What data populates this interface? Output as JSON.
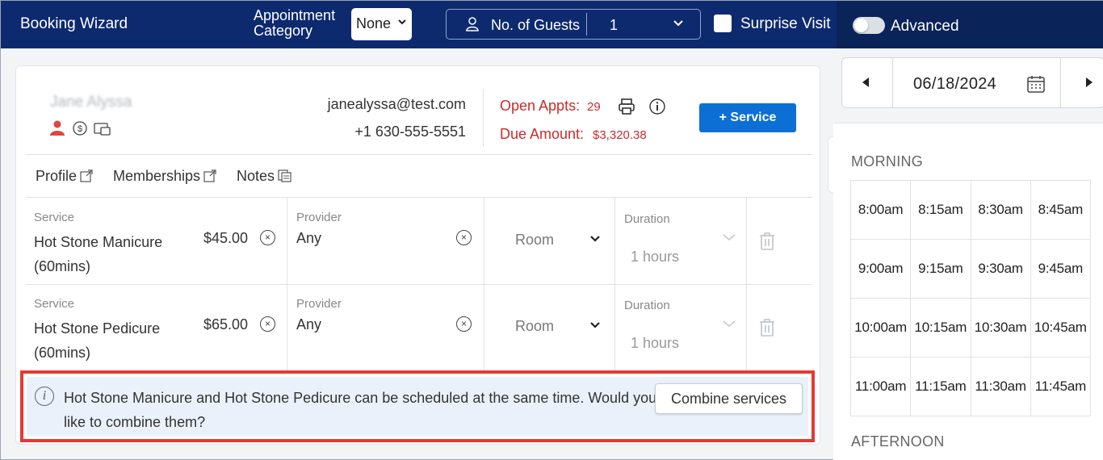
{
  "header": {
    "title": "Booking Wizard",
    "category_label": "Appointment Category",
    "category_value": "None",
    "guests_label": "No. of Guests",
    "guests_value": "1",
    "surprise_label": "Surprise Visit",
    "advanced_label": "Advanced"
  },
  "client": {
    "name": "Jane Alyssa",
    "email": "janealyssa@test.com",
    "phone": "+1 630-555-5551",
    "open_appts_label": "Open Appts:",
    "open_appts_value": "29",
    "due_label": "Due Amount:",
    "due_value": "$3,320.38",
    "service_button": "Service"
  },
  "tabs": [
    "Profile",
    "Memberships",
    "Notes"
  ],
  "labels": {
    "service": "Service",
    "provider": "Provider",
    "duration": "Duration"
  },
  "services": [
    {
      "name": "Hot Stone Manicure (60mins)",
      "price": "$45.00",
      "provider": "Any",
      "room": "Room",
      "duration": "1 hours"
    },
    {
      "name": "Hot Stone Pedicure (60mins)",
      "price": "$65.00",
      "provider": "Any",
      "room": "Room",
      "duration": "1 hours"
    }
  ],
  "notice": {
    "message": "Hot Stone Manicure and Hot Stone Pedicure can be scheduled at the same time. Would you like to combine them?",
    "button": "Combine services"
  },
  "calendar": {
    "date": "06/18/2024",
    "morning_label": "MORNING",
    "afternoon_label": "AFTERNOON",
    "morning_slots": [
      [
        "8:00am",
        "8:15am",
        "8:30am",
        "8:45am"
      ],
      [
        "9:00am",
        "9:15am",
        "9:30am",
        "9:45am"
      ],
      [
        "10:00am",
        "10:15am",
        "10:30am",
        "10:45am"
      ],
      [
        "11:00am",
        "11:15am",
        "11:30am",
        "11:45am"
      ]
    ]
  },
  "colors": {
    "header_bg": "#0d2a6e",
    "accent_blue": "#0c6fd6",
    "alert_red": "#cc2b2b",
    "notice_border": "#e53935"
  }
}
